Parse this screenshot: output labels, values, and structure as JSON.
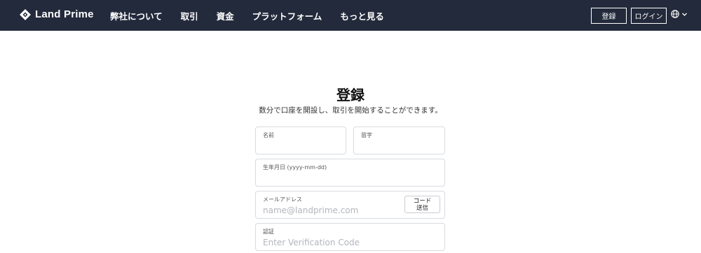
{
  "header": {
    "brand": "Land Prime",
    "nav": [
      "弊社について",
      "取引",
      "資金",
      "プラットフォーム",
      "もっと見る"
    ],
    "register_label": "登録",
    "login_label": "ログイン",
    "language_icon": "globe-icon",
    "colors": {
      "bar": "#232a3b",
      "text": "#ffffff"
    }
  },
  "main": {
    "title": "登録",
    "subtitle": "数分で口座を開設し、取引を開始することができます。",
    "fields": {
      "first_name_label": "名前",
      "last_name_label": "苗字",
      "dob_label": "生年月日 (yyyy-mm-dd)",
      "email_label": "メールアドレス",
      "email_placeholder": "name@landprime.com",
      "send_code_line1": "コード",
      "send_code_line2": "送信",
      "code_label": "認証",
      "code_placeholder": "Enter Verification Code"
    }
  }
}
